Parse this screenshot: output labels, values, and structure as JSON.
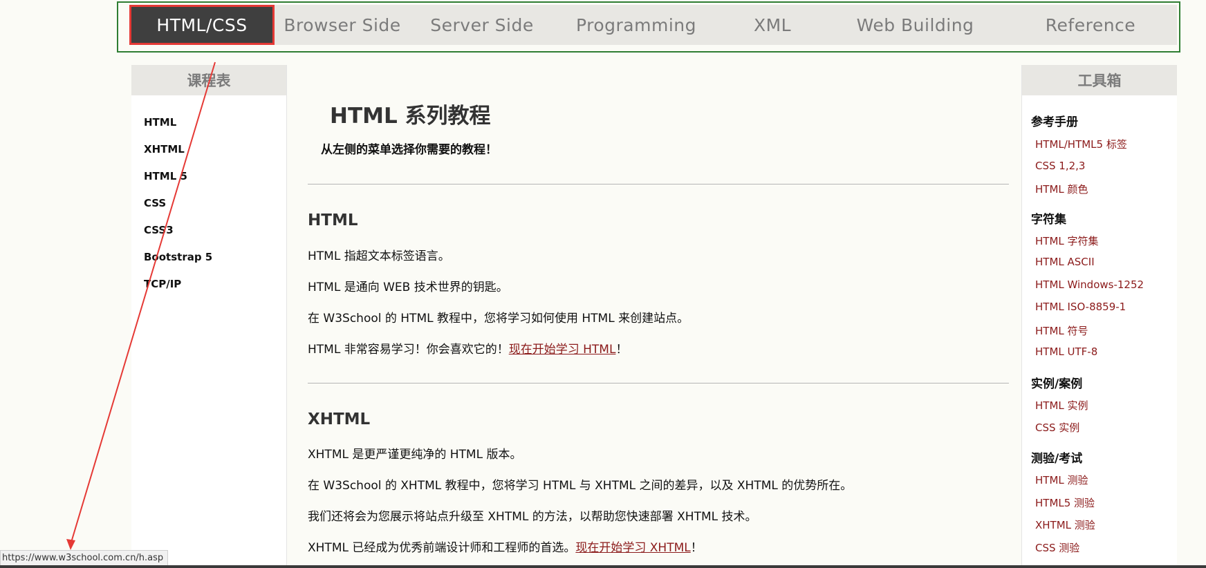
{
  "topnav": {
    "items": [
      {
        "label": "HTML/CSS",
        "active": true
      },
      {
        "label": "Browser Side"
      },
      {
        "label": "Server Side"
      },
      {
        "label": "Programming"
      },
      {
        "label": "XML"
      },
      {
        "label": "Web Building"
      },
      {
        "label": "Reference"
      }
    ]
  },
  "left_sidebar": {
    "title": "课程表",
    "items": [
      "HTML",
      "XHTML",
      "HTML 5",
      "CSS",
      "CSS3",
      "Bootstrap 5",
      "TCP/IP"
    ]
  },
  "main": {
    "title": "HTML 系列教程",
    "intro": "从左侧的菜单选择你需要的教程！",
    "sections": [
      {
        "heading": "HTML",
        "paragraphs": [
          "HTML 指超文本标签语言。",
          "HTML 是通向 WEB 技术世界的钥匙。",
          "在 W3School 的 HTML 教程中，您将学习如何使用 HTML 来创建站点。"
        ],
        "cta_prefix": "HTML 非常容易学习！你会喜欢它的！",
        "cta_link": "现在开始学习 HTML",
        "cta_suffix": "！"
      },
      {
        "heading": "XHTML",
        "paragraphs": [
          "XHTML 是更严谨更纯净的 HTML 版本。",
          "在 W3School 的 XHTML 教程中，您将学习 HTML 与 XHTML 之间的差异，以及 XHTML 的优势所在。",
          "我们还将会为您展示将站点升级至 XHTML 的方法，以帮助您快速部署 XHTML 技术。"
        ],
        "cta_prefix": "XHTML 已经成为优秀前端设计师和工程师的首选。",
        "cta_link": "现在开始学习 XHTML",
        "cta_suffix": "！"
      }
    ]
  },
  "right_sidebar": {
    "title": "工具箱",
    "groups": [
      {
        "title": "参考手册",
        "links": [
          "HTML/HTML5 标签",
          "CSS 1,2,3",
          "HTML 颜色"
        ]
      },
      {
        "title": "字符集",
        "links": [
          "HTML 字符集",
          "HTML ASCII",
          "HTML Windows-1252",
          "HTML ISO-8859-1",
          "HTML 符号",
          "HTML UTF-8"
        ]
      },
      {
        "title": "实例/案例",
        "links": [
          "HTML 实例",
          "CSS 实例"
        ]
      },
      {
        "title": "测验/考试",
        "links": [
          "HTML 测验",
          "HTML5 测验",
          "XHTML 测验",
          "CSS 测验"
        ]
      }
    ]
  },
  "status_bar": {
    "url": "https://www.w3school.com.cn/h.asp"
  },
  "colors": {
    "nav_bg": "#e8e7e3",
    "nav_active_bg": "#3f3f3f",
    "nav_active_outline": "#e53935",
    "nav_frame": "#2e7d32",
    "link": "#8b1a1a",
    "annotation_arrow": "#e53935"
  }
}
